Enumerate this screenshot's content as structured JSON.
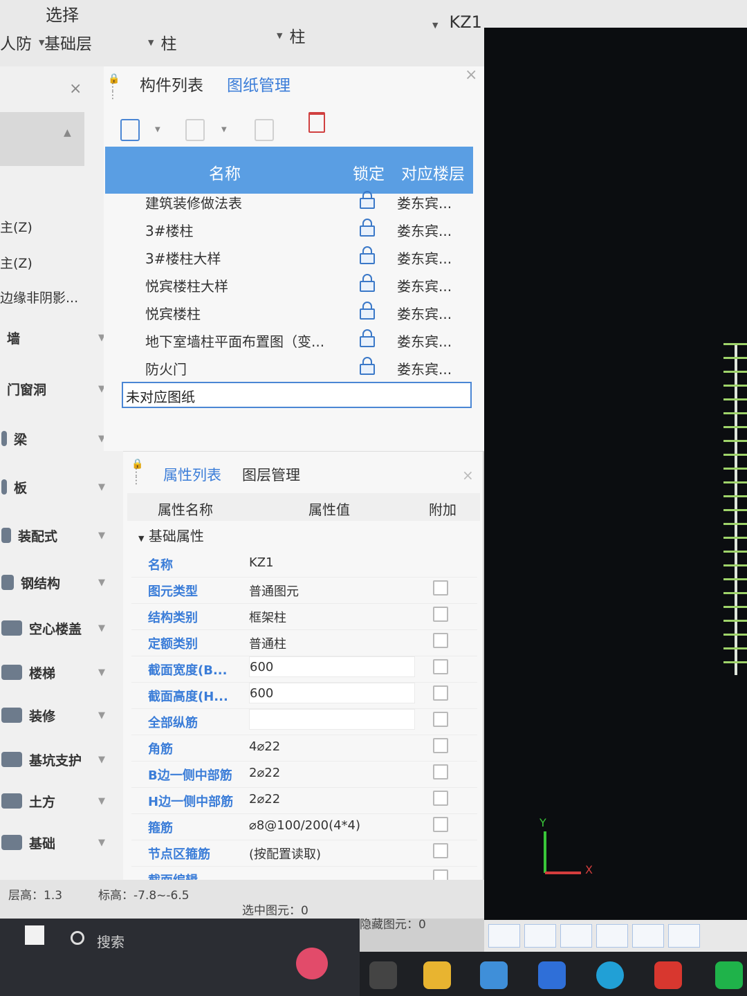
{
  "topbar": {
    "select_label": "选择",
    "combo_1": "人防",
    "combo_2": "基础层",
    "combo_3": "柱",
    "combo_4": "柱",
    "combo_5": "KZ1"
  },
  "sidebar": {
    "close_label": "×",
    "texts": [
      "主(Z)",
      "主(Z)",
      "边缘非阴影..."
    ],
    "categories": [
      "墙",
      "门窗洞",
      "梁",
      "板",
      "装配式",
      "钢结构",
      "空心楼盖",
      "楼梯",
      "装修",
      "基坑支护",
      "土方",
      "基础"
    ]
  },
  "drawing_panel": {
    "tab_component": "构件列表",
    "tab_drawing": "图纸管理",
    "close_label": "×",
    "columns": [
      "名称",
      "锁定",
      "对应楼层"
    ],
    "rows": [
      {
        "name": "建筑装修做法表",
        "floor": "娄东宾..."
      },
      {
        "name": "3#楼柱",
        "floor": "娄东宾..."
      },
      {
        "name": "3#楼柱大样",
        "floor": "娄东宾..."
      },
      {
        "name": "悦宾楼柱大样",
        "floor": "娄东宾..."
      },
      {
        "name": "悦宾楼柱",
        "floor": "娄东宾..."
      },
      {
        "name": "地下室墙柱平面布置图（变...",
        "floor": "娄东宾..."
      },
      {
        "name": "防火门",
        "floor": "娄东宾..."
      }
    ],
    "unassigned": "未对应图纸"
  },
  "props_panel": {
    "tab_props": "属性列表",
    "tab_layers": "图层管理",
    "close_label": "×",
    "columns": [
      "属性名称",
      "属性值",
      "附加"
    ],
    "group_basic": "基础属性",
    "rows": [
      {
        "name": "名称",
        "value": "KZ1",
        "check": false
      },
      {
        "name": "图元类型",
        "value": "普通图元",
        "check": true
      },
      {
        "name": "结构类别",
        "value": "框架柱",
        "check": true
      },
      {
        "name": "定额类别",
        "value": "普通柱",
        "check": true
      },
      {
        "name": "截面宽度(B...",
        "value": "600",
        "check": true
      },
      {
        "name": "截面高度(H...",
        "value": "600",
        "check": true
      },
      {
        "name": "全部纵筋",
        "value": "",
        "check": true
      },
      {
        "name": "角筋",
        "value": "4⌀22",
        "check": true
      },
      {
        "name": "B边一侧中部筋",
        "value": "2⌀22",
        "check": true
      },
      {
        "name": "H边一侧中部筋",
        "value": "2⌀22",
        "check": true
      },
      {
        "name": "箍筋",
        "value": "⌀8@100/200(4*4)",
        "check": true
      },
      {
        "name": "节点区箍筋",
        "value": "(按配置读取)",
        "check": true
      },
      {
        "name": "截面编辑",
        "value": "",
        "check": true
      }
    ]
  },
  "collapse_label": "‹",
  "axis": {
    "y": "Y",
    "x": "X"
  },
  "statusbar": {
    "floor_height": "层高：1.3",
    "elevation": "标高：-7.8~-6.5",
    "selected": "选中图元：0",
    "hidden": "隐藏图元：0"
  },
  "taskbar": {
    "search_text": "搜索"
  },
  "colors": {
    "accent": "#5a9ee3",
    "link_blue": "#3b7dd8",
    "canvas_bg": "#0b0d10"
  }
}
